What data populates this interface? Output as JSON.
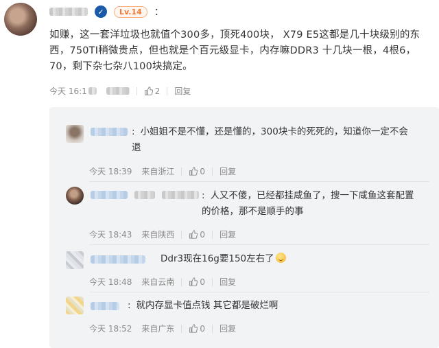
{
  "main": {
    "level_badge": "Lv.14",
    "colon": "：",
    "text": "如赚，这一套洋垃圾也就值个300多，顶死400块， X79 E5这都是几十块级别的东西，750TI稍微贵点，但也就是个百元级显卡，内存嘛DDR3 十几块一根，4根6，70，剩下杂七杂八100块搞定。",
    "time": "今天 16:1",
    "like_count": "2",
    "reply_label": "回复"
  },
  "replies": [
    {
      "text": "小姐姐不是不懂，还是懂的，300块卡的死死的，知道你一定不会退",
      "time": "今天 18:39",
      "location": "来自浙江",
      "likes": "0",
      "reply_label": "回复"
    },
    {
      "text": "人又不傻，已经都挂咸鱼了，搜一下咸鱼这套配置的价格，那不是顺手的事",
      "time": "今天 18:43",
      "location": "来自陕西",
      "likes": "0",
      "reply_label": "回复"
    },
    {
      "text": "Ddr3现在16g要150左右了",
      "time": "今天 18:48",
      "location": "来自云南",
      "likes": "0",
      "reply_label": "回复"
    },
    {
      "text": "就内存显卡值点钱 其它都是破烂啊",
      "time": "今天 18:52",
      "location": "来自广东",
      "likes": "0",
      "reply_label": "回复"
    }
  ],
  "colors": {
    "level_text": "#f07a3a",
    "verified": "#1a5aa8",
    "reply_bg": "#f2f3f5",
    "meta_text": "#8a8a8a"
  }
}
